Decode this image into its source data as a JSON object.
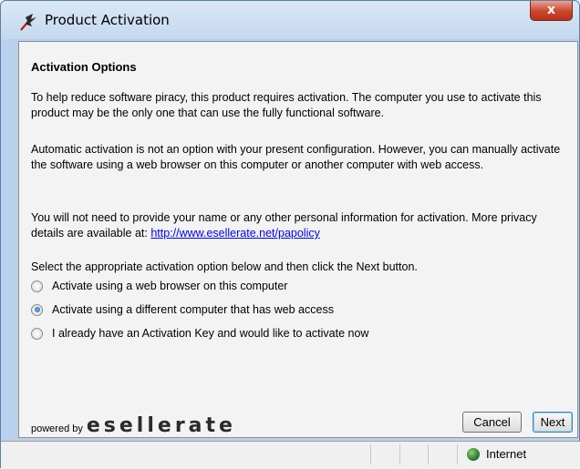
{
  "window": {
    "title": "Product Activation",
    "close_glyph": "x"
  },
  "main": {
    "heading": "Activation Options",
    "paragraph1": "To help reduce software piracy, this product requires activation. The computer you use to activate this product may be the only one that can use the fully functional software.",
    "paragraph2": "Automatic activation is not an option with your present configuration. However, you can manually activate the software using a web browser on this computer or another computer with web access.",
    "paragraph3_prefix": "You will not need to provide your name or any other personal information for activation. More privacy details are available at: ",
    "privacy_link": "http://www.esellerate.net/papolicy",
    "select_instruction": "Select the appropriate activation option below and then click the Next button.",
    "options": [
      {
        "label": "Activate using a web browser on this computer",
        "selected": false
      },
      {
        "label": "Activate using a different computer that has web access",
        "selected": true
      },
      {
        "label": "I already have an Activation Key and would like to activate now",
        "selected": false
      }
    ]
  },
  "footer": {
    "powered_by": "powered by",
    "brand": "esellerate",
    "cancel_label": "Cancel",
    "next_label": "Next"
  },
  "statusbar": {
    "zone": "Internet",
    "zone_icon": "globe-icon"
  },
  "colors": {
    "titlebar": "#c4d8ee",
    "close_button": "#c9462c",
    "link": "#0000ee"
  }
}
